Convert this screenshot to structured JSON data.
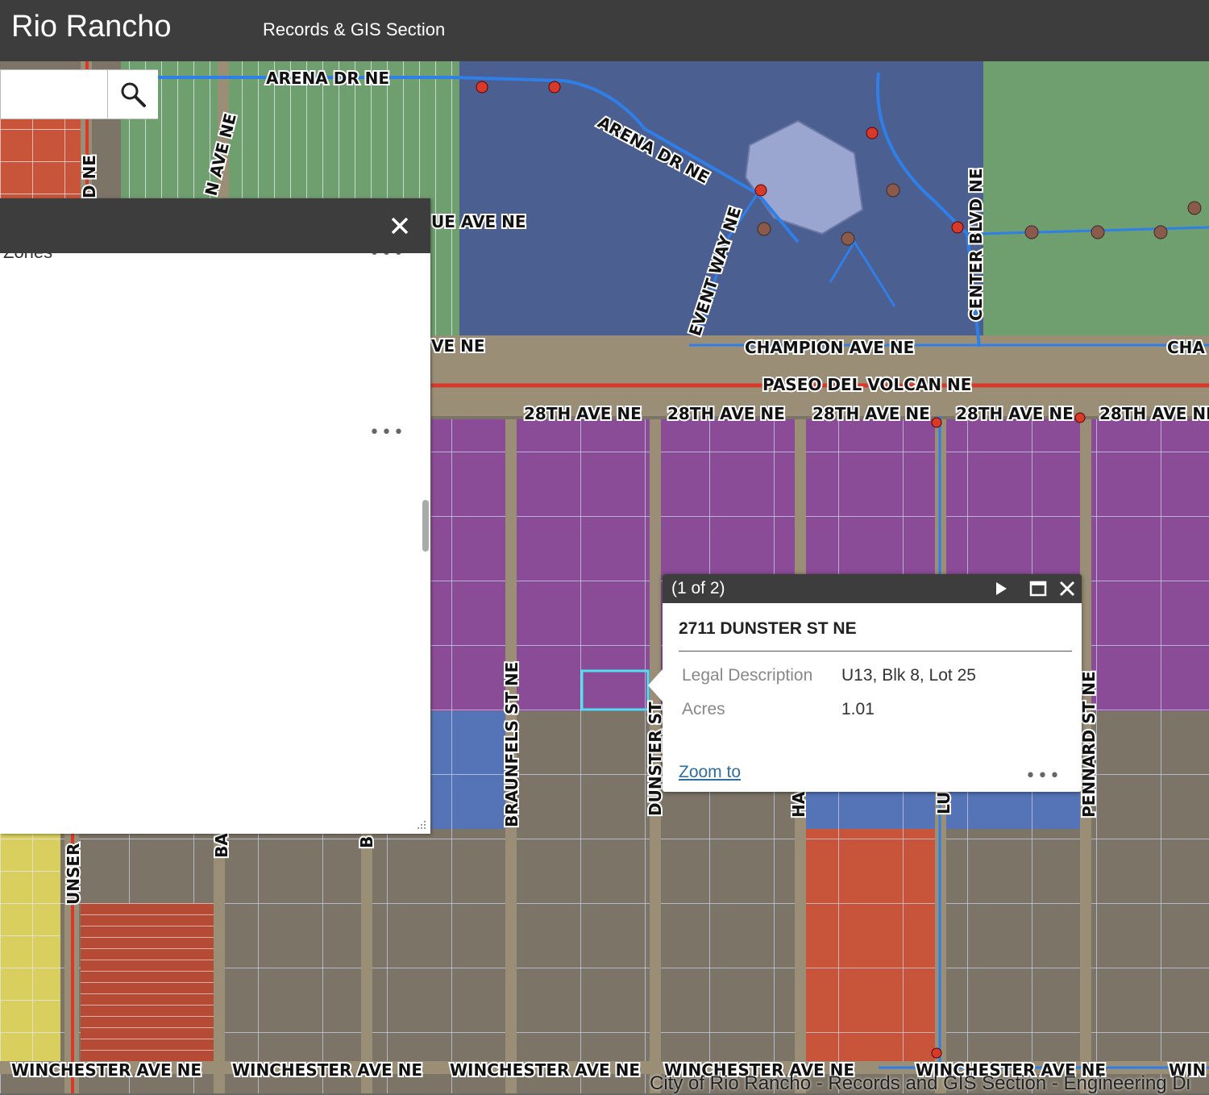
{
  "header": {
    "title": "Rio Rancho",
    "subtitle": "Records & GIS Section"
  },
  "search": {
    "value": "",
    "placeholder": ""
  },
  "panel": {
    "clipped_label": "Zones",
    "more_glyph": "•••"
  },
  "map": {
    "street_labels": [
      "ARENA DR NE",
      "ARENA DR NE",
      "EVENT WAY NE",
      "CENTER BLVD NE",
      "UE AVE NE",
      "VE NE",
      "CHAMPION AVE NE",
      "CHA",
      "PASEO DEL VOLCAN NE",
      "28TH AVE NE",
      "28TH AVE NE",
      "28TH AVE NE",
      "28TH AVE NE",
      "28TH AVE NI",
      "BRAUNFELS ST NE",
      "DUNSTER ST",
      "PENNARD ST NE",
      "UNSER",
      "D NE",
      "N AVE NE",
      "BA",
      "B",
      "HA",
      "LU",
      "WINCHESTER AVE NE",
      "WINCHESTER AVE NE",
      "WINCHESTER AVE NE",
      "WINCHESTER AVE NE",
      "WINCHESTER AVE NE",
      "WIN"
    ],
    "attribution": "City of Rio Rancho - Records and GIS Section - Engineering Di",
    "colors": {
      "zone_purple": "#8a4c96",
      "zone_blue": "#5574b8",
      "zone_green": "#6f9e6f",
      "zone_red": "#c8553a",
      "zone_yellow": "#d8cf5e",
      "zone_tan": "#7c7466",
      "water_line": "#2f7fe8",
      "arterial": "#d83a2a",
      "selection": "#4fe0f0"
    }
  },
  "popup": {
    "count": "(1 of 2)",
    "title": "2711 DUNSTER ST NE",
    "attributes": [
      {
        "label": "Legal Description",
        "value": "U13, Blk 8, Lot 25"
      },
      {
        "label": "Acres",
        "value": "1.01"
      }
    ],
    "zoom_label": "Zoom to",
    "more_glyph": "•••"
  }
}
